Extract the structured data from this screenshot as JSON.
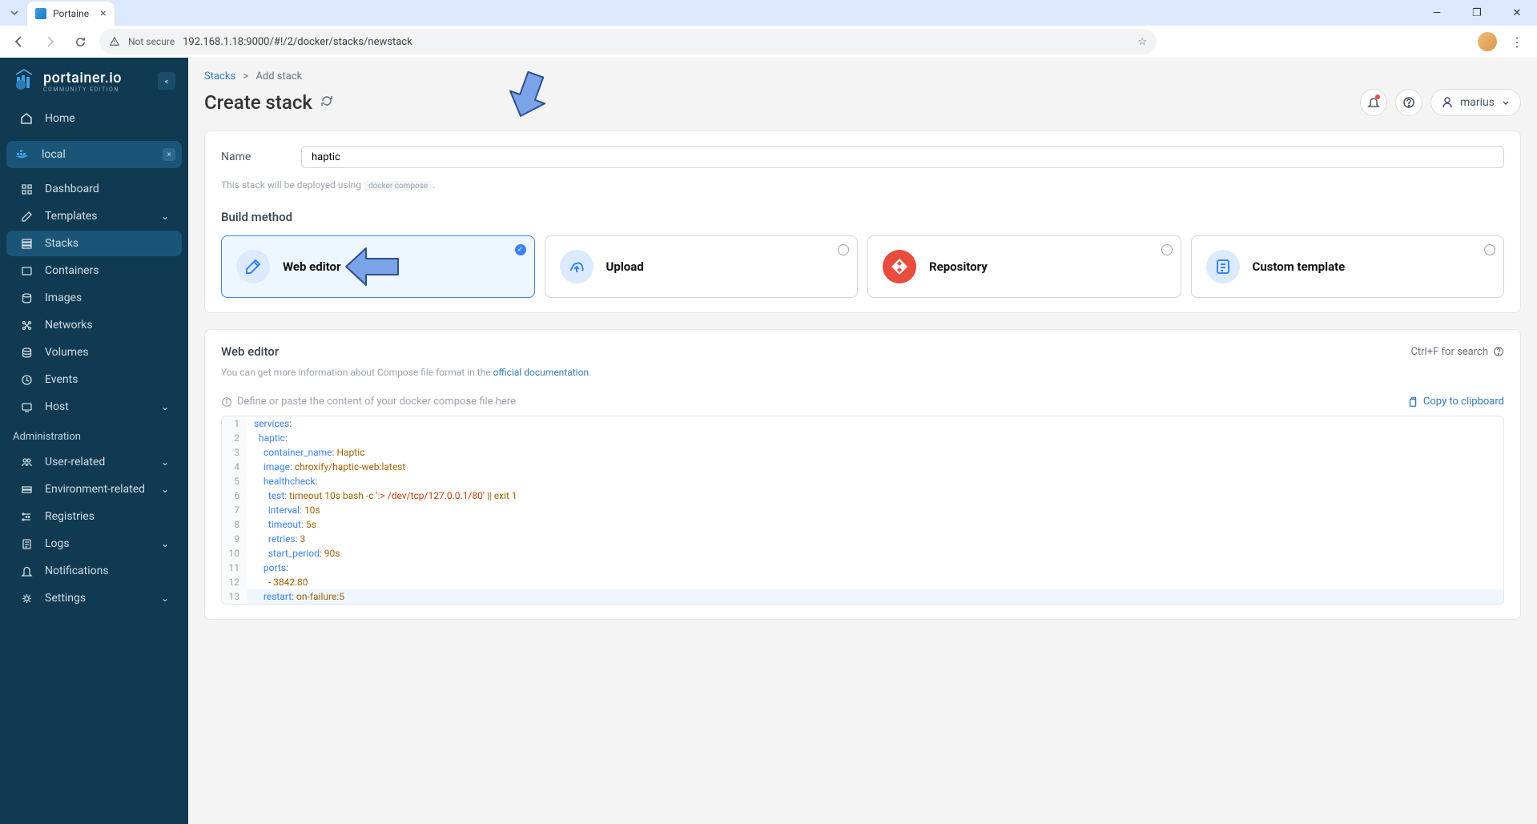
{
  "browser": {
    "tab_title": "Portaine",
    "url_insecure_label": "Not secure",
    "url": "192.168.1.18:9000/#!/2/docker/stacks/newstack"
  },
  "sidebar": {
    "brand": "portainer.io",
    "brand_sub": "COMMUNITY EDITION",
    "home": "Home",
    "env_name": "local",
    "items": [
      {
        "label": "Dashboard"
      },
      {
        "label": "Templates",
        "chevron": true
      },
      {
        "label": "Stacks",
        "active": true
      },
      {
        "label": "Containers"
      },
      {
        "label": "Images"
      },
      {
        "label": "Networks"
      },
      {
        "label": "Volumes"
      },
      {
        "label": "Events"
      },
      {
        "label": "Host",
        "chevron": true
      }
    ],
    "admin_label": "Administration",
    "admin_items": [
      {
        "label": "User-related",
        "chevron": true
      },
      {
        "label": "Environment-related",
        "chevron": true
      },
      {
        "label": "Registries"
      },
      {
        "label": "Logs",
        "chevron": true
      },
      {
        "label": "Notifications"
      },
      {
        "label": "Settings",
        "chevron": true
      }
    ]
  },
  "breadcrumb": {
    "root": "Stacks",
    "sep": ">",
    "current": "Add stack"
  },
  "header": {
    "title": "Create stack",
    "user": "marius"
  },
  "form": {
    "name_label": "Name",
    "name_value": "haptic",
    "hint_prefix": "This stack will be deployed using ",
    "hint_code": "docker compose",
    "hint_suffix": ".",
    "build_method_label": "Build method",
    "methods": [
      {
        "title": "Web editor",
        "selected": true
      },
      {
        "title": "Upload"
      },
      {
        "title": "Repository"
      },
      {
        "title": "Custom template"
      }
    ]
  },
  "editor": {
    "title": "Web editor",
    "shortcut_hint": "Ctrl+F for search",
    "desc_prefix": "You can get more information about Compose file format in the ",
    "doc_link": "official documentation",
    "desc_suffix": ".",
    "placeholder": "Define or paste the content of your docker compose file here",
    "copy_label": "Copy to clipboard"
  },
  "code": {
    "lines": [
      {
        "n": 1,
        "indent": 0,
        "key": "services",
        "colon": true
      },
      {
        "n": 2,
        "indent": 1,
        "key": "haptic",
        "colon": true
      },
      {
        "n": 3,
        "indent": 2,
        "key": "container_name",
        "val": "Haptic"
      },
      {
        "n": 4,
        "indent": 2,
        "key": "image",
        "val": "chroxify/haptic-web:latest"
      },
      {
        "n": 5,
        "indent": 2,
        "key": "healthcheck",
        "colon": true
      },
      {
        "n": 6,
        "indent": 3,
        "key": "test",
        "val_parts": [
          "timeout 10s bash -c ",
          "':> /dev/tcp/127.0.0.1/80'",
          " || exit 1"
        ]
      },
      {
        "n": 7,
        "indent": 3,
        "key": "interval",
        "val": "10s"
      },
      {
        "n": 8,
        "indent": 3,
        "key": "timeout",
        "val": "5s"
      },
      {
        "n": 9,
        "indent": 3,
        "key": "retries",
        "val": "3"
      },
      {
        "n": 10,
        "indent": 3,
        "key": "start_period",
        "val": "90s"
      },
      {
        "n": 11,
        "indent": 2,
        "key": "ports",
        "colon": true
      },
      {
        "n": 12,
        "indent": 3,
        "raw": "- 3842:80"
      },
      {
        "n": 13,
        "indent": 2,
        "key": "restart",
        "val": "on-failure:5",
        "active": true
      }
    ]
  }
}
